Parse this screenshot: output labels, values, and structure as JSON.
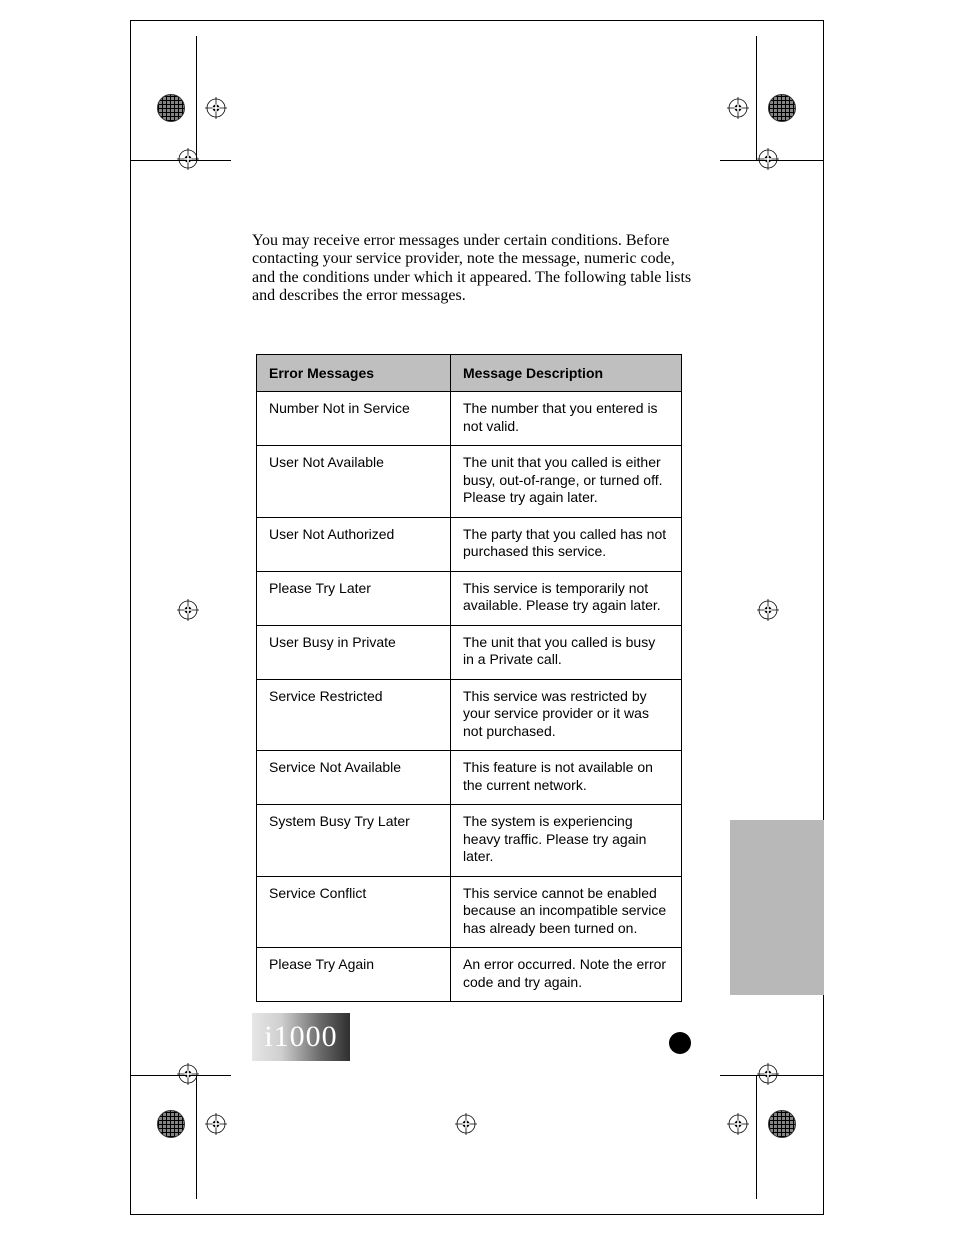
{
  "intro_text": "You may receive error messages under certain conditions. Before contacting your service provider, note the message, numeric code, and the conditions under which it appeared. The following table lists and describes the error messages.",
  "table": {
    "header_left": "Error Messages",
    "header_right": "Message Description",
    "rows": [
      {
        "msg": "Number Not in Service",
        "desc": "The number that you entered is not valid."
      },
      {
        "msg": "User Not Available",
        "desc": "The unit that you called is either busy, out-of-range, or turned off. Please try again later."
      },
      {
        "msg": "User Not Authorized",
        "desc": "The party that you called has not purchased this service."
      },
      {
        "msg": "Please Try Later",
        "desc": "This service is temporarily not available. Please try again later."
      },
      {
        "msg": "User Busy in Private",
        "desc": "The unit that you called is busy in a Private call."
      },
      {
        "msg": "Service Restricted",
        "desc": "This service was restricted by your service provider or it was not purchased."
      },
      {
        "msg": "Service Not Available",
        "desc": "This feature is not available on the current network."
      },
      {
        "msg": "System Busy Try Later",
        "desc": "The system is experiencing heavy traffic. Please try again later."
      },
      {
        "msg": "Service Conflict",
        "desc": "This service cannot be enabled because an incompatible service has already been turned on."
      },
      {
        "msg": "Please Try Again",
        "desc": "An error occurred. Note the error code and try again."
      }
    ]
  },
  "footer_badge": "i1000"
}
